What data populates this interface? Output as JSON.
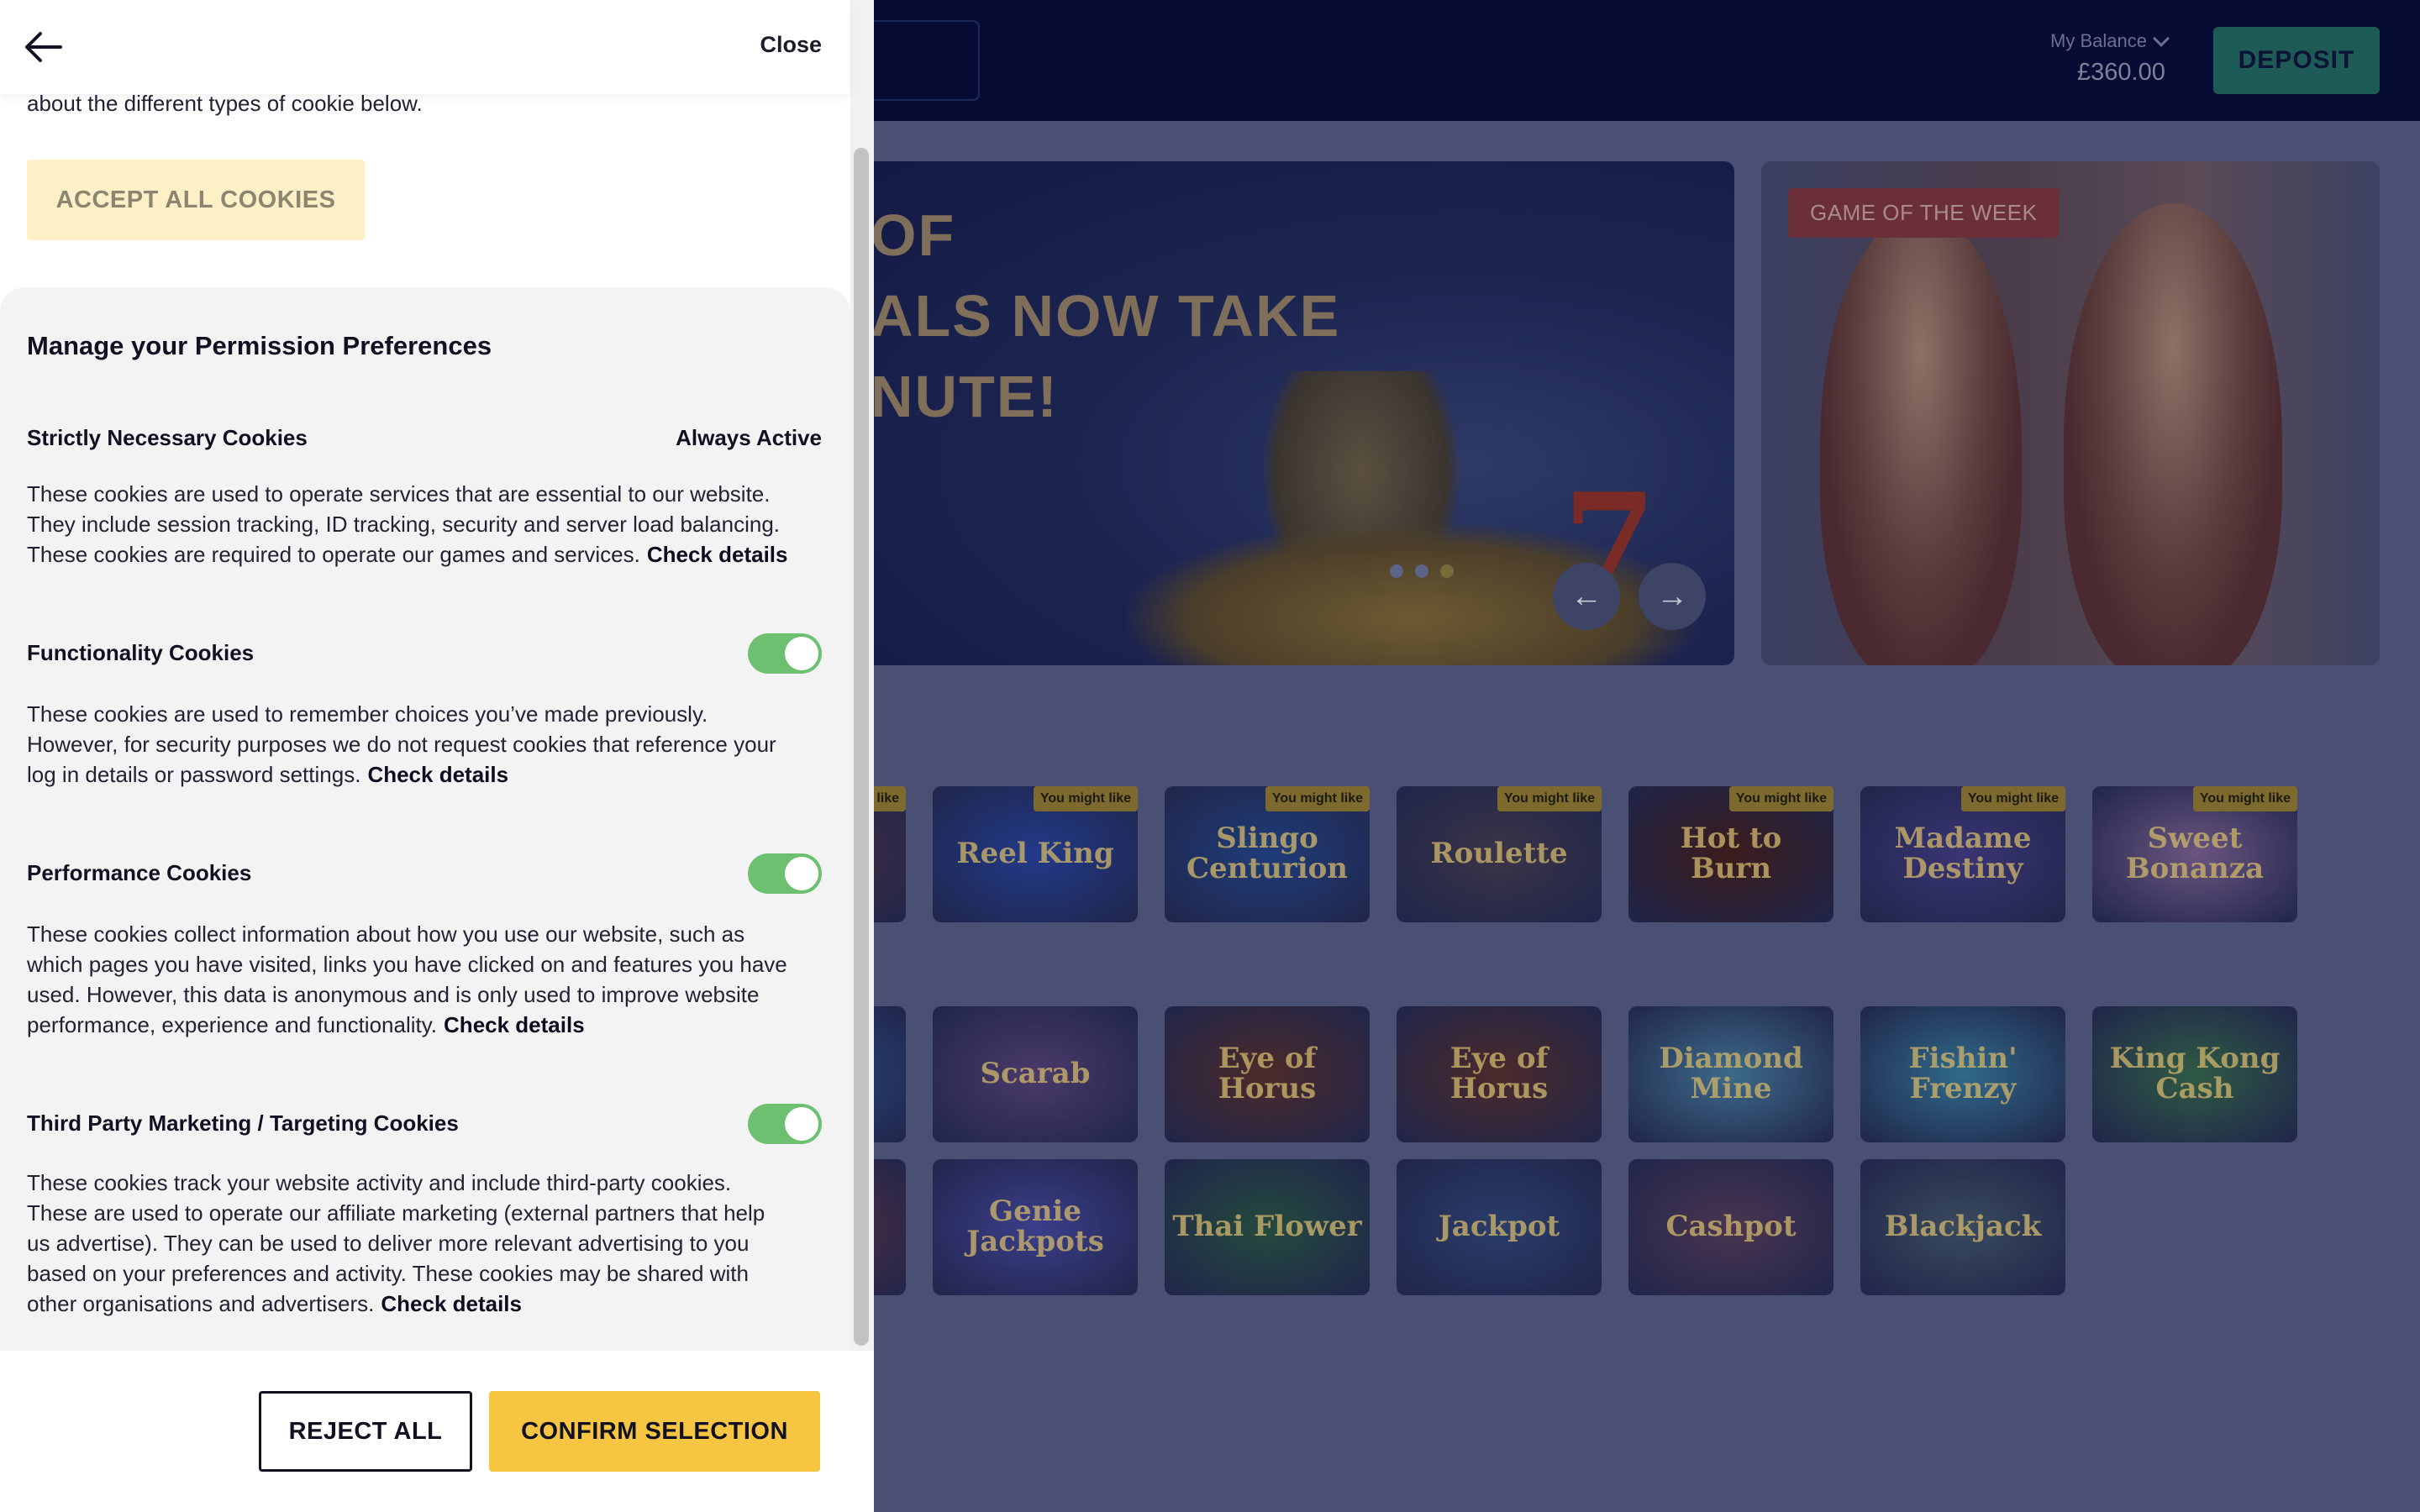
{
  "site": {
    "balance_label": "My Balance",
    "balance_value": "£360.00",
    "deposit_label": "DEPOSIT",
    "hero_lines": [
      "OF",
      "ALS NOW TAKE",
      "NUTE!"
    ],
    "hero_slides": 3,
    "hero_active_slide": 3,
    "game_of_week_label": "GAME OF THE WEEK",
    "recommend_tag": "You might like",
    "row1": [
      "",
      "Reel King",
      "Slingo Centurion",
      "Roulette",
      "Hot to Burn",
      "Madame Destiny",
      "Sweet Bonanza"
    ],
    "row2": [
      "",
      "Scarab",
      "Eye of Horus",
      "Eye of Horus",
      "Diamond Mine",
      "Fishin' Frenzy",
      "King Kong Cash"
    ],
    "row3": [
      "",
      "Genie Jackpots",
      "Thai Flower",
      "Jackpot",
      "Cashpot",
      "Blackjack"
    ]
  },
  "panel": {
    "close_label": "Close",
    "intro_tail": "about the different types of cookie below.",
    "accept_all_label": "ACCEPT ALL COOKIES",
    "prefs_title": "Manage your Permission Preferences",
    "check_details": "Check details",
    "sections": [
      {
        "title": "Strictly Necessary Cookies",
        "status": "Always Active",
        "lines": [
          "These cookies are used to operate services that are essential to our website.",
          "They include session tracking, ID tracking, security and server load balancing.",
          "These cookies are required to operate our games and services."
        ]
      },
      {
        "title": "Functionality Cookies",
        "enabled": true,
        "lines": [
          "These cookies are used to remember choices you’ve made previously.",
          "However, for security purposes we do not request cookies that reference your",
          "log in details or password settings."
        ]
      },
      {
        "title": "Performance Cookies",
        "enabled": true,
        "lines": [
          "These cookies collect information about how you use our website, such as",
          "which pages you have visited, links you have clicked on and features you have",
          "used. However, this data is anonymous and is only used to improve website",
          "performance, experience and functionality."
        ]
      },
      {
        "title": "Third Party Marketing / Targeting Cookies",
        "enabled": true,
        "lines": [
          "These cookies track your website activity and include third-party cookies.",
          "These are used to operate our affiliate marketing (external partners that help",
          "us advertise). They can be used to deliver more relevant advertising to you",
          "based on your preferences and activity. These cookies may be shared with",
          "other organisations and advertisers."
        ]
      }
    ],
    "reject_label": "REJECT ALL",
    "confirm_label": "CONFIRM SELECTION"
  },
  "colors": {
    "overlay_bg": "#4a5073",
    "header_bg": "#060c33",
    "accent_yellow": "#f6c642",
    "toggle_on": "#6cc070"
  }
}
